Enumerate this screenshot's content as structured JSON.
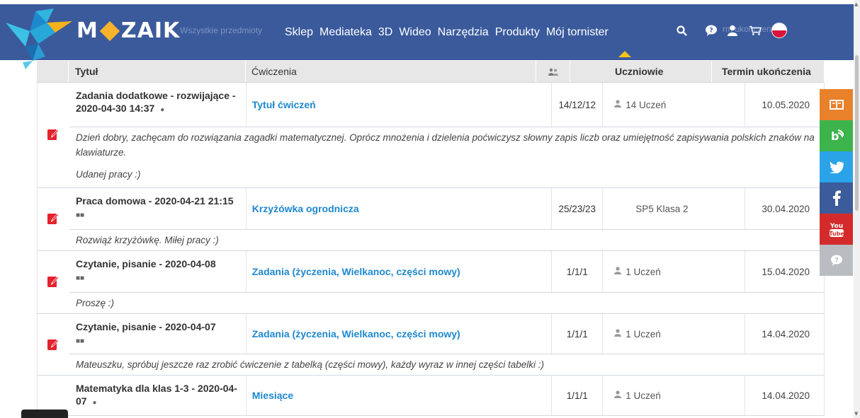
{
  "header": {
    "logo_text_left": "M",
    "logo_text_right": "ZAIK",
    "ghost_subjects": "Wszystkie przedmioty",
    "ghost_right": "rm  ukończeni",
    "nav": [
      {
        "label": "Sklep"
      },
      {
        "label": "Mediateka"
      },
      {
        "label": "3D"
      },
      {
        "label": "Wideo"
      },
      {
        "label": "Narzędzia"
      },
      {
        "label": "Produkty"
      },
      {
        "label": "Mój tornister"
      }
    ],
    "active_nav": "Mój tornister",
    "icons": [
      "search-icon",
      "help-icon",
      "user-icon",
      "cart-icon",
      "flag-pl-icon"
    ],
    "colors": {
      "bar": "#3a5a9c",
      "accent": "#f7b32b"
    }
  },
  "table": {
    "headers": {
      "title": "Tytuł",
      "exercises": "Ćwiczenia",
      "group_icon": "group-icon",
      "students": "Uczniowie",
      "due": "Termin ukończenia"
    },
    "rows": [
      {
        "title": "Zadania dodatkowe - rozwijające - 2020-04-30 14:37",
        "title_icon": "●",
        "exercise": "Tytuł ćwiczeń",
        "count": "14/12/12",
        "students": "14 Uczeń",
        "due": "10.05.2020",
        "notes": [
          "Dzień dobry, zachęcam do rozwiązania zagadki matematycznej. Oprócz mnożenia i dzielenia poćwiczysz słowny zapis liczb oraz umiejętność zapisywania polskich znaków na klawiaturze.",
          "Udanej pracy :)"
        ]
      },
      {
        "title": "Praca domowa - 2020-04-21 21:15",
        "title_icon": "■■",
        "exercise": "Krzyżówka ogrodnicza",
        "count": "25/23/23",
        "students": "SP5 Klasa 2",
        "due": "30.04.2020",
        "notes": [
          "Rozwiąż krzyżówkę. Miłej pracy :)"
        ]
      },
      {
        "title": "Czytanie, pisanie - 2020-04-08",
        "title_icon": "■■",
        "exercise": "Zadania (życzenia, Wielkanoc, części mowy)",
        "count": "1/1/1",
        "students": "1 Uczeń",
        "due": "15.04.2020",
        "notes": [
          "Proszę :)"
        ]
      },
      {
        "title": "Czytanie, pisanie - 2020-04-07",
        "title_icon": "■■",
        "exercise": "Zadania (życzenia, Wielkanoc, części mowy)",
        "count": "1/1/1",
        "students": "1 Uczeń",
        "due": "14.04.2020",
        "notes": [
          "Mateuszku, spróbuj jeszcze raz zrobić ćwiczenie z tabelką (części mowy), każdy wyraz w innej części tabelki :)"
        ]
      },
      {
        "title": "Matematyka dla klas 1-3 - 2020-04-07",
        "title_icon": "●",
        "exercise": "Miesiące",
        "count": "1/1/1",
        "students": "1 Uczeń",
        "due": "14.04.2020",
        "notes": []
      }
    ]
  },
  "social": [
    {
      "icon": "book-icon",
      "color": "#e8812a"
    },
    {
      "icon": "share-icon",
      "color": "#3db34b"
    },
    {
      "icon": "twitter-icon",
      "color": "#2aa3e8"
    },
    {
      "icon": "facebook-icon",
      "color": "#3b5b9a"
    },
    {
      "icon": "youtube-icon",
      "color": "#d32b2b"
    },
    {
      "icon": "help-icon",
      "color": "#b9bcc1"
    }
  ]
}
